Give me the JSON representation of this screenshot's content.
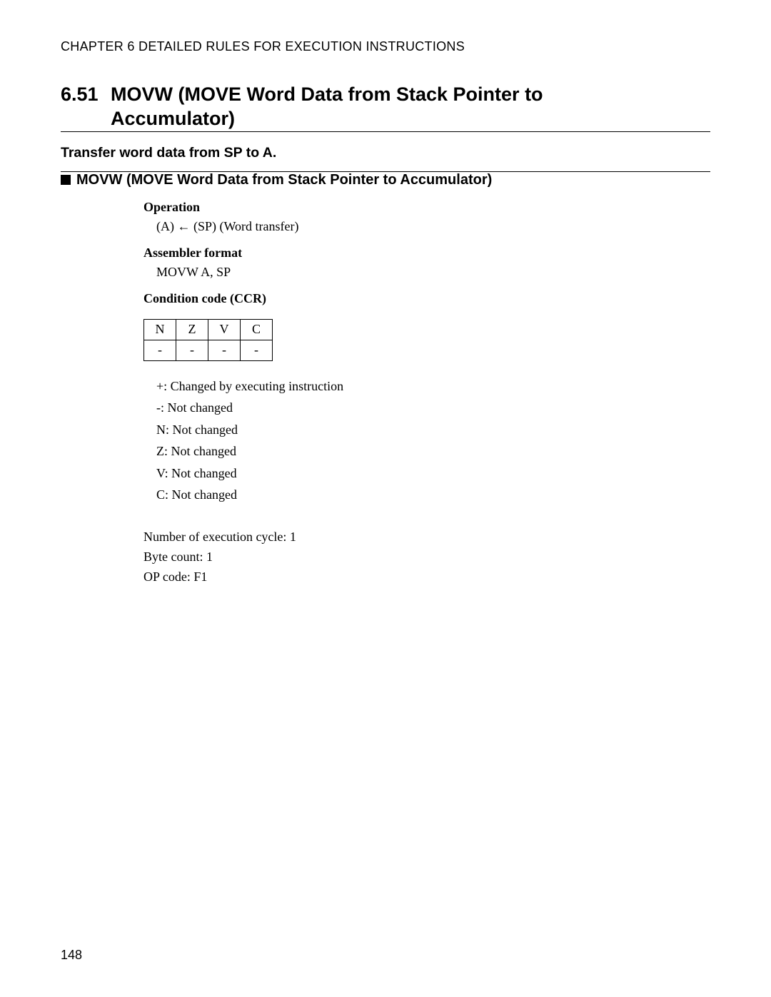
{
  "header": {
    "chapter": "CHAPTER 6  DETAILED RULES FOR EXECUTION INSTRUCTIONS"
  },
  "section": {
    "number": "6.51",
    "title": "MOVW (MOVE Word Data from Stack Pointer to Accumulator)"
  },
  "summary": "Transfer word data from SP to A.",
  "subheading": "MOVW (MOVE Word Data from Stack Pointer to Accumulator)",
  "operation": {
    "label": "Operation",
    "text": "(A) ← (SP) (Word transfer)"
  },
  "assembler": {
    "label": "Assembler format",
    "text": "MOVW A, SP"
  },
  "ccr": {
    "label": "Condition code (CCR)",
    "headers": [
      "N",
      "Z",
      "V",
      "C"
    ],
    "row": [
      "-",
      "-",
      "-",
      "-"
    ],
    "legend": [
      "+: Changed by executing instruction",
      "-: Not changed",
      "N: Not changed",
      "Z: Not changed",
      "V: Not changed",
      "C: Not changed"
    ]
  },
  "extras": [
    "Number of execution cycle: 1",
    "Byte count: 1",
    "OP code: F1"
  ],
  "page_number": "148"
}
